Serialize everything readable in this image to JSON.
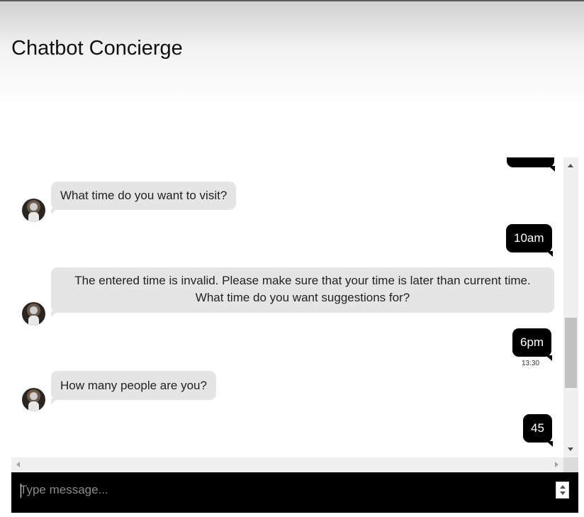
{
  "header": {
    "title": "Chatbot Concierge"
  },
  "messages": [
    {
      "sender": "bot",
      "text": "What time do you want to visit?"
    },
    {
      "sender": "user",
      "text": "10am"
    },
    {
      "sender": "bot",
      "line1": "The entered time is invalid. Please make sure that your time is later than current time.",
      "line2": "What time do you want suggestions for?"
    },
    {
      "sender": "user",
      "text": "6pm",
      "time": "13:30"
    },
    {
      "sender": "bot",
      "text": "How many people are you?"
    },
    {
      "sender": "user",
      "text": "45"
    }
  ],
  "input": {
    "placeholder": "Type message..."
  },
  "colors": {
    "user_bubble": "#000000",
    "bot_bubble": "#e5e5e5",
    "input_bar": "#000000"
  },
  "icons": {
    "avatar": "bot-avatar-photo",
    "scroll_up": "arrow-up-icon",
    "scroll_down": "arrow-down-icon"
  }
}
